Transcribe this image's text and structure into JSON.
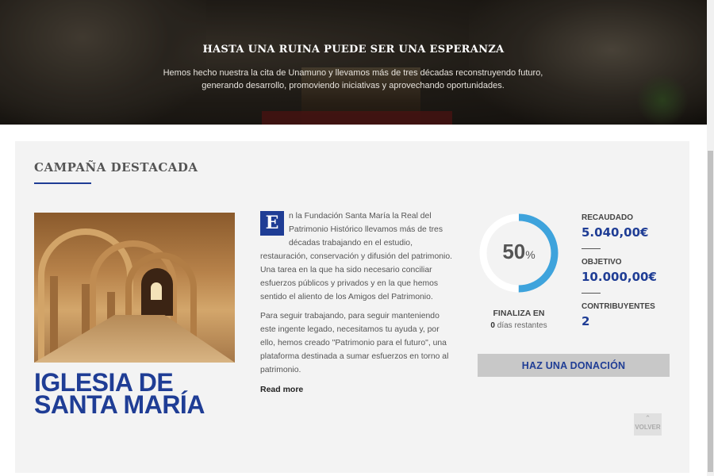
{
  "hero": {
    "title": "HASTA UNA RUINA PUEDE SER UNA ESPERANZA",
    "text": "Hemos hecho nuestra la cita de Unamuno y llevamos más de tres décadas reconstruyendo futuro, generando desarrollo, promoviendo iniciativas y aprovechando oportunidades."
  },
  "featured": {
    "section_title": "CAMPAÑA DESTACADA",
    "campaign_name": "IGLESIA DE SANTA MARÍA",
    "dropcap": "E",
    "paragraph1_first": "n la Fundación Santa María la Real del Patrimonio Histórico llevamos más de tres décadas trabajando en el estudio,",
    "paragraph1_rest": "restauración, conservación y difusión del patrimonio. Una tarea en la que ha sido necesario conciliar esfuerzos públicos y privados y en la que hemos sentido el aliento de los Amigos del Patrimonio.",
    "paragraph2": "Para seguir trabajando, para seguir manteniendo este ingente legado, necesitamos tu ayuda y, por ello, hemos creado \"Patrimonio para el futuro\", una plataforma destinada a sumar esfuerzos en torno al patrimonio.",
    "read_more": "Read more",
    "progress_percent": 50,
    "progress_number": "50",
    "progress_symbol": "%",
    "ends_label": "FINALIZA EN",
    "days_count": "0",
    "days_text": " días restantes",
    "stats": {
      "raised_label": "RECAUDADO",
      "raised_value": "5.040,00€",
      "goal_label": "OBJETIVO",
      "goal_value": "10.000,00€",
      "contributors_label": "CONTRIBUYENTES",
      "contributors_value": "2"
    },
    "donate_label": "HAZ UNA DONACIÓN",
    "back_label": "VOLVER"
  },
  "colors": {
    "brand_blue": "#1f3d95",
    "ring_blue": "#3ea3dc",
    "ring_track": "#ffffff",
    "card_bg": "#f3f3f3"
  }
}
